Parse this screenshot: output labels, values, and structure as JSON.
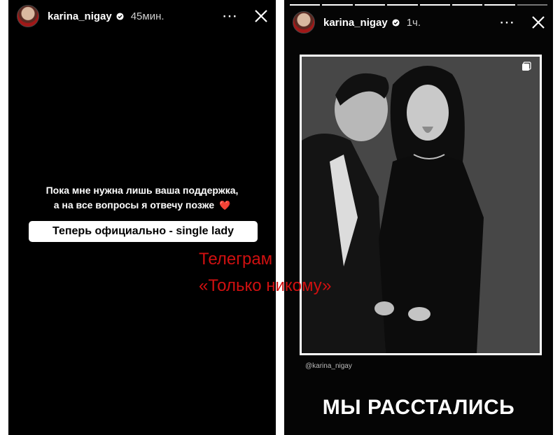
{
  "left_story": {
    "username": "karina_nigay",
    "timestamp": "45мин.",
    "caption_line1": "Пока мне нужна лишь ваша поддержка,",
    "caption_line2": "а на все вопросы я отвечу позже",
    "caption_emoji": "❤️",
    "highlight_text": "Теперь официально - single lady"
  },
  "right_story": {
    "username": "karina_nigay",
    "timestamp": "1ч.",
    "photo_handle": "@karina_nigay",
    "headline": "МЫ РАССТАЛИСЬ"
  },
  "watermark": {
    "line1": "Телеграм",
    "line2": "«Только никому»",
    "color": "#d01010"
  },
  "icons": {
    "more": "more-options-icon",
    "close": "close-icon",
    "verified": "verified-badge-icon"
  }
}
